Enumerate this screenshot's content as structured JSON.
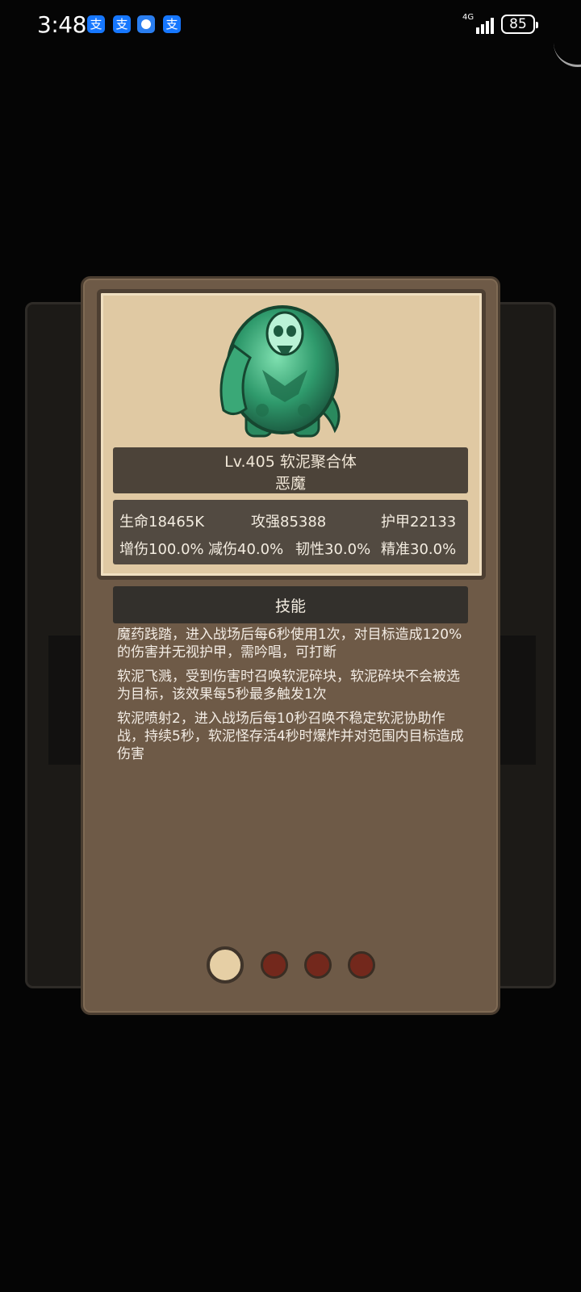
{
  "status_bar": {
    "time": "3:48",
    "app_icons": [
      "支",
      "支",
      "globe-icon",
      "支"
    ],
    "network": "4G",
    "battery": "85"
  },
  "monster": {
    "title": "Lv.405 软泥聚合体",
    "type": "恶魔"
  },
  "stats": {
    "row1": [
      "生命18465K",
      "攻强85388",
      "护甲22133"
    ],
    "row2": [
      "增伤100.0%",
      "减伤40.0%",
      "韧性30.0%",
      "精准30.0%"
    ]
  },
  "skills": {
    "header": "技能",
    "items": [
      "魔药践踏，进入战场后每6秒使用1次，对目标造成120%的伤害并无视护甲，需吟唱，可打断",
      "软泥飞溅，受到伤害时召唤软泥碎块，软泥碎块不会被选为目标，该效果每5秒最多触发1次",
      "软泥喷射2，进入战场后每10秒召唤不稳定软泥协助作战，持续5秒，软泥怪存活4秒时爆炸并对范围内目标造成伤害"
    ]
  },
  "pagination": {
    "pages": 4,
    "current": 1
  },
  "colors": {
    "card": "#6e5a47",
    "parchment": "#e0c9a3",
    "banner": "#4c4339",
    "dot_active": "#e6cfa5",
    "dot_idle": "#73281c"
  }
}
